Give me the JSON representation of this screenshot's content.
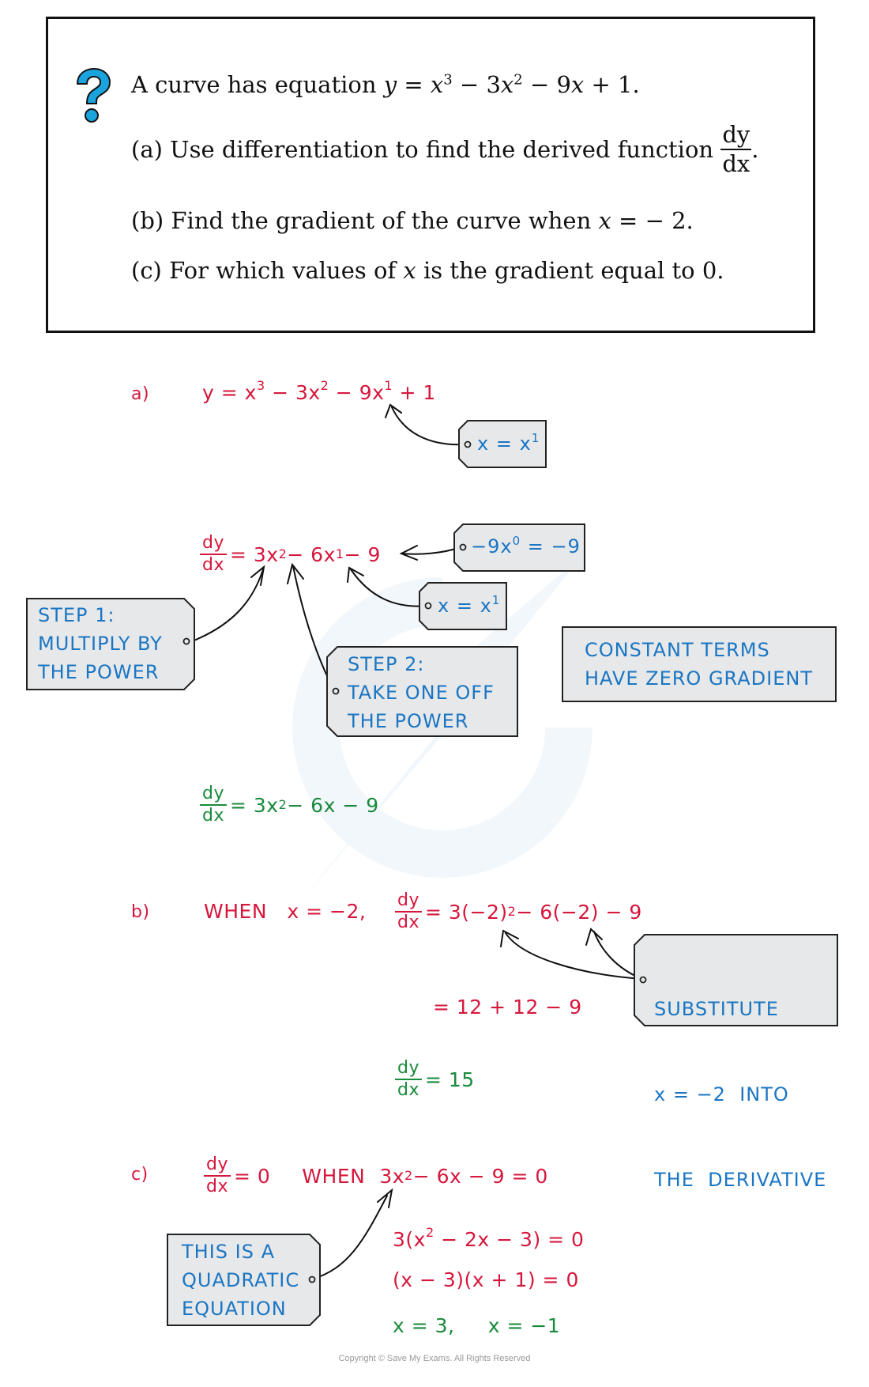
{
  "question": {
    "icon": "question-mark-icon",
    "intro_text": "A curve has equation",
    "intro_equation": {
      "lhs": "y",
      "t1_base": "x",
      "t1_exp": "3",
      "t2": "− 3",
      "t2_base": "x",
      "t2_exp": "2",
      "t3": "− 9",
      "t3_base": "x",
      "t4": "+ 1."
    },
    "part_a": {
      "label": "(a)",
      "text": "Use differentiation to find the derived function",
      "frac_num": "dy",
      "frac_den": "dx",
      "end": "."
    },
    "part_b": {
      "label": "(b)",
      "text": "Find the gradient of the curve when",
      "var": "x",
      "rest": " = − 2."
    },
    "part_c": {
      "label": "(c)",
      "text_before": "For which values of",
      "var": "x",
      "text_after": "is the gradient equal to 0."
    }
  },
  "solution": {
    "a": {
      "label": "a)",
      "equation": {
        "pre": "y = x",
        "e1": "3",
        "mid1": " − 3x",
        "e2": "2",
        "mid2": " −  9x",
        "e3": "1",
        "post": " + 1"
      },
      "tag_x_power": {
        "base": "x = x",
        "exp": "1"
      },
      "derivative_step": {
        "frac_num": "dy",
        "frac_den": "dx",
        "pre": " = 3x",
        "e1": "2",
        "mid": " − 6x",
        "e2": "1",
        "post": " − 9"
      },
      "tag_constant": {
        "pre": "−9x",
        "exp": "0",
        "post": " = −9"
      },
      "tag_x_power_2": {
        "base": "x = x",
        "exp": "1"
      },
      "step1_box": [
        "STEP  1:",
        "MULTIPLY  BY",
        "THE  POWER"
      ],
      "step2_box": [
        "STEP  2:",
        "TAKE  ONE  OFF",
        "THE  POWER"
      ],
      "constant_box": [
        "CONSTANT  TERMS",
        "HAVE  ZERO  GRADIENT"
      ],
      "result": {
        "frac_num": "dy",
        "frac_den": "dx",
        "pre": " = 3x",
        "e1": "2",
        "post": " − 6x − 9"
      }
    },
    "b": {
      "label": "b)",
      "when_text": "WHEN   x = −2,",
      "substitution": {
        "frac_num": "dy",
        "frac_den": "dx",
        "pre": " = 3(−2)",
        "e1": "2",
        "post": " − 6(−2) − 9"
      },
      "substitute_box": [
        "SUBSTITUTE",
        "x = −2  INTO",
        "THE  DERIVATIVE"
      ],
      "simplified": "= 12 + 12 − 9",
      "result": {
        "frac_num": "dy",
        "frac_den": "dx",
        "post": " = 15"
      }
    },
    "c": {
      "label": "c)",
      "condition": {
        "frac_num": "dy",
        "frac_den": "dx",
        "post": " = 0",
        "when": "WHEN",
        "eq_pre": "3x",
        "e1": "2",
        "eq_post": " − 6x − 9 = 0"
      },
      "quadratic_box": [
        "THIS  IS  A",
        "QUADRATIC",
        "EQUATION"
      ],
      "factor_1": {
        "pre": "3(x",
        "e1": "2",
        "post": " − 2x − 3) = 0"
      },
      "factor_2": "(x − 3)(x + 1) = 0",
      "answer": "x = 3,     x = −1"
    }
  },
  "footer": {
    "copyright": "Copyright © Save My Exams. All Rights Reserved"
  },
  "colors": {
    "working": "#d6173c",
    "answer": "#1a8a3c",
    "annotation": "#1a76c4",
    "tag_fill": "#e7e8e9",
    "icon": "#1aa3dd"
  }
}
